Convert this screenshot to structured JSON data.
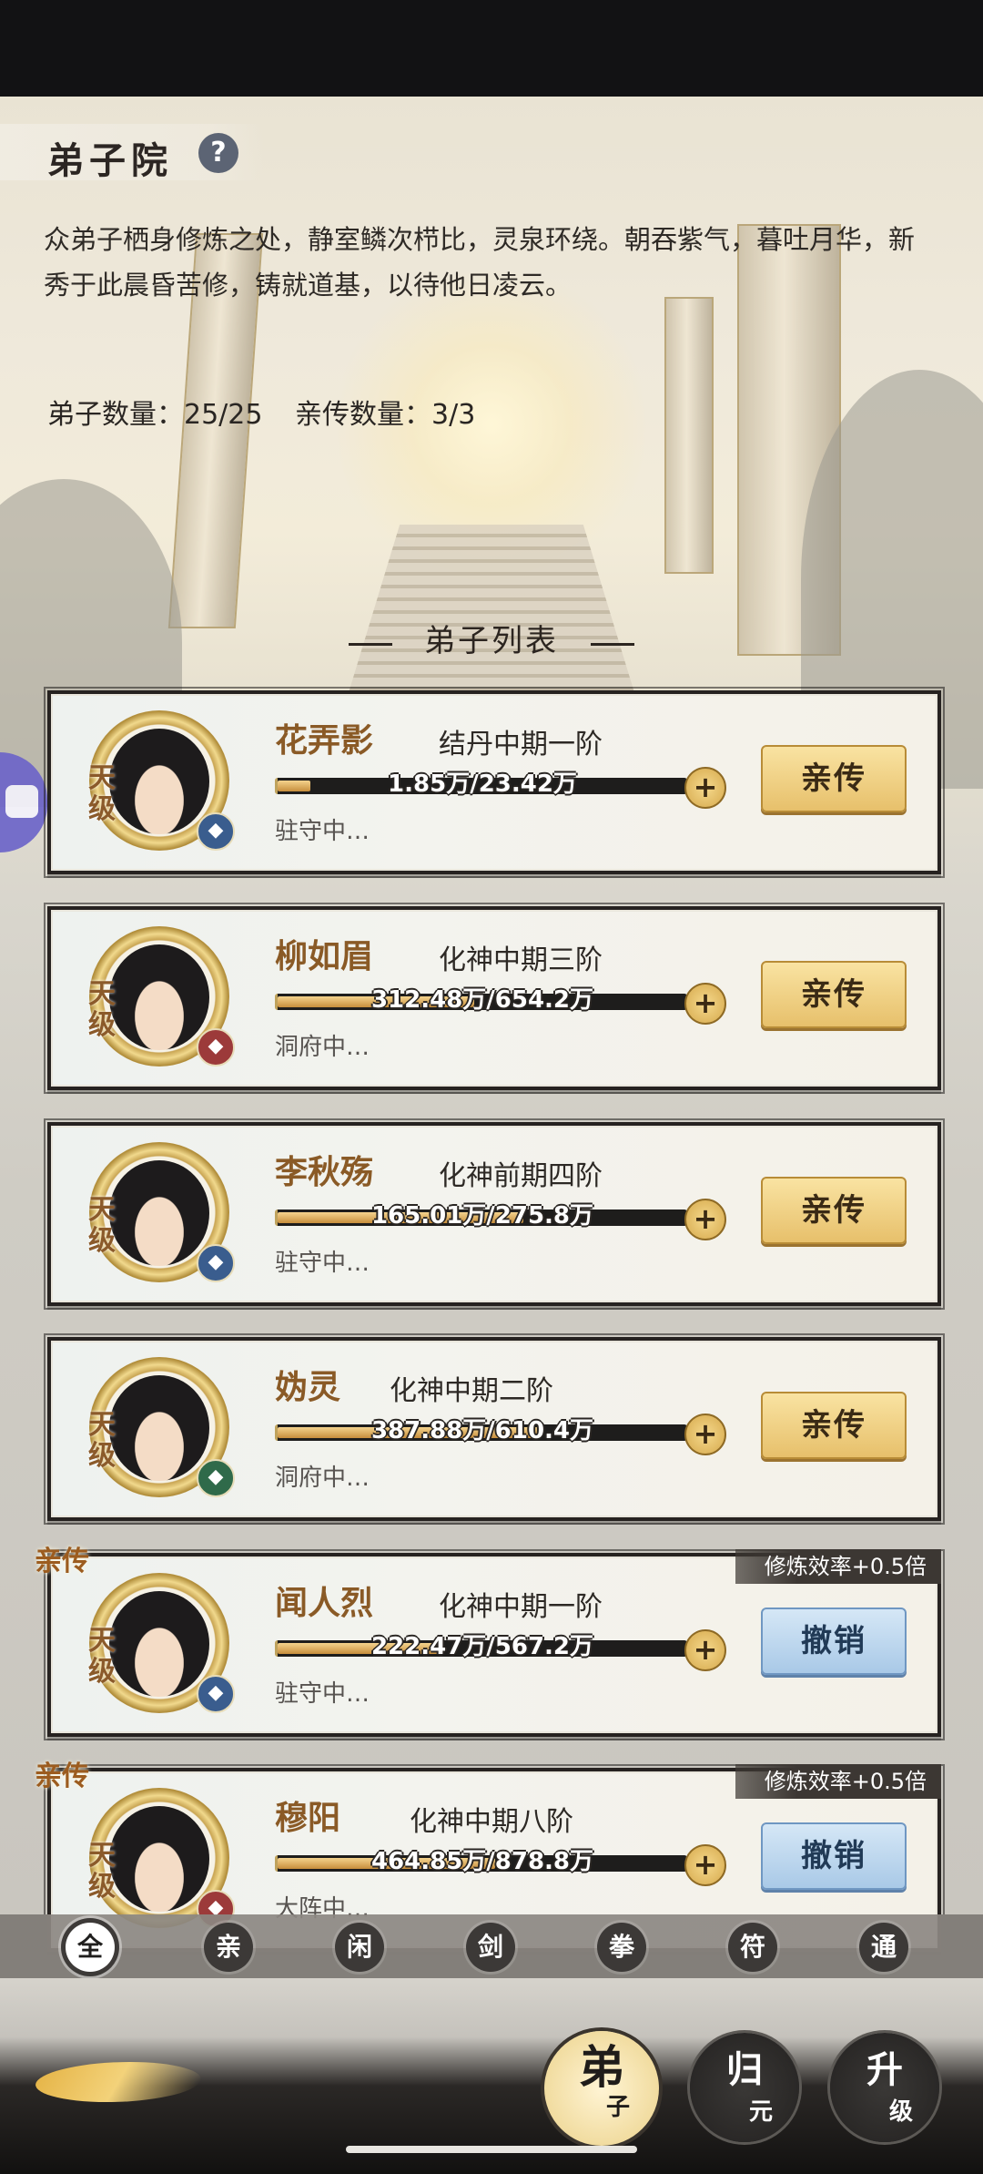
{
  "header": {
    "title": "弟子院",
    "help_icon": "?",
    "description": "众弟子栖身修炼之处，静室鳞次栉比，灵泉环绕。朝吞紫气，暮吐月华，新秀于此晨昏苦修，铸就道基，以待他日凌云。",
    "disciple_count": "弟子数量：25/25",
    "direct_count": "亲传数量：3/3"
  },
  "list": {
    "heading": "弟子列表",
    "disciples": [
      {
        "name": "花弄影",
        "realm": "结丹中期一阶",
        "grade": "天级",
        "progress": "1.85万/23.42万",
        "progress_fraction": 0.08,
        "status": "驻守中…",
        "element": "water",
        "action": "亲传",
        "is_direct": false
      },
      {
        "name": "柳如眉",
        "realm": "化神中期三阶",
        "grade": "天级",
        "progress": "312.48万/654.2万",
        "progress_fraction": 0.48,
        "status": "洞府中…",
        "element": "fire",
        "action": "亲传",
        "is_direct": false
      },
      {
        "name": "李秋殇",
        "realm": "化神前期四阶",
        "grade": "天级",
        "progress": "165.01万/275.8万",
        "progress_fraction": 0.6,
        "status": "驻守中…",
        "element": "water",
        "action": "亲传",
        "is_direct": false
      },
      {
        "name": "妫灵",
        "realm": "化神中期二阶",
        "grade": "天级",
        "progress": "387.88万/610.4万",
        "progress_fraction": 0.64,
        "status": "洞府中…",
        "element": "wind",
        "action": "亲传",
        "is_direct": false
      },
      {
        "name": "闻人烈",
        "realm": "化神中期一阶",
        "grade": "天级",
        "progress": "222.47万/567.2万",
        "progress_fraction": 0.39,
        "status": "驻守中…",
        "element": "water",
        "action": "撤销",
        "is_direct": true,
        "direct_label": "亲传",
        "bonus": "修炼效率+0.5倍"
      },
      {
        "name": "穆阳",
        "realm": "化神中期八阶",
        "grade": "天级",
        "progress": "464.85万/878.8万",
        "progress_fraction": 0.53,
        "status": "大阵中…",
        "element": "fire",
        "action": "撤销",
        "is_direct": true,
        "direct_label": "亲传",
        "bonus": "修炼效率+0.5倍"
      }
    ]
  },
  "filters": [
    "全",
    "亲",
    "闲",
    "剑",
    "拳",
    "符",
    "通"
  ],
  "filter_active": 0,
  "bottom_nav": [
    {
      "line1": "弟",
      "line2": "子"
    },
    {
      "line1": "归",
      "line2": "元"
    },
    {
      "line1": "升",
      "line2": "级"
    }
  ],
  "colors": {
    "name": "#8a5a26",
    "gold_button": "#e7c06b",
    "blue_button": "#a9c9e7"
  }
}
